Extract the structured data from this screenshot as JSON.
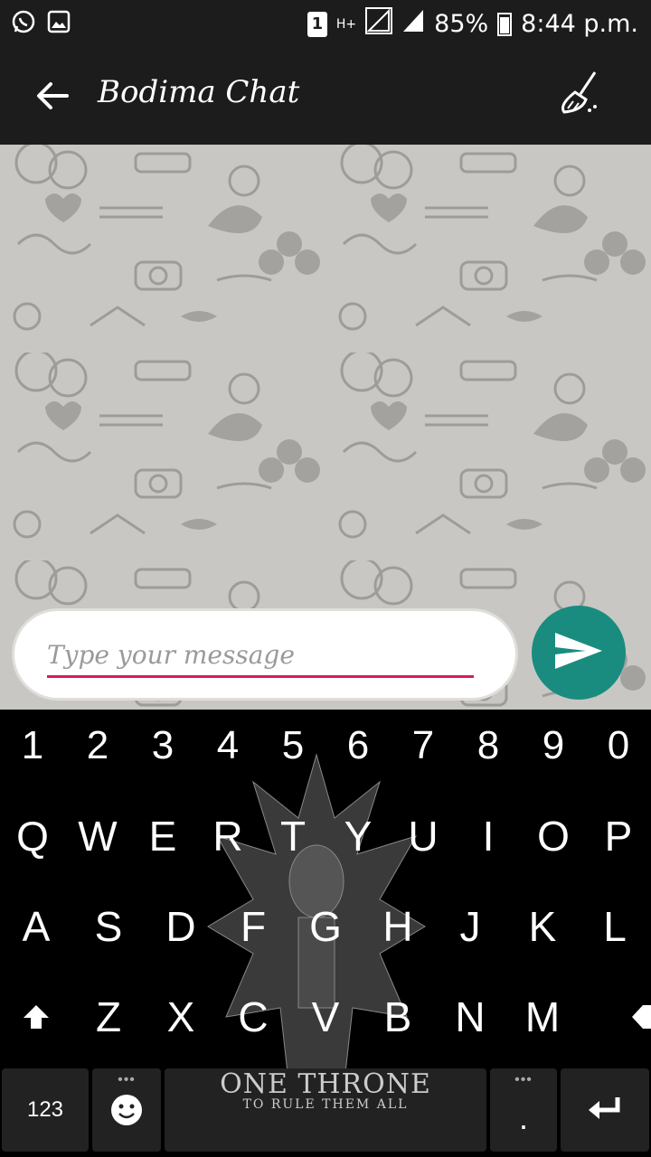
{
  "status_bar": {
    "sim_slot": "1",
    "network_type": "H+",
    "battery_percent": "85%",
    "time": "8:44 p.m.",
    "icons": [
      "whatsapp-icon",
      "gallery-icon",
      "signal-icon",
      "battery-icon"
    ]
  },
  "app_bar": {
    "title": "Bodima Chat",
    "back_icon": "arrow-left-icon",
    "clear_icon": "broom-icon"
  },
  "chat": {
    "messages": []
  },
  "composer": {
    "placeholder": "Type your message",
    "value": "",
    "send_icon": "send-icon",
    "underline_color": "#d81b60",
    "send_color": "#198c7f"
  },
  "keyboard": {
    "numbers": [
      "1",
      "2",
      "3",
      "4",
      "5",
      "6",
      "7",
      "8",
      "9",
      "0"
    ],
    "row1": [
      "Q",
      "W",
      "E",
      "R",
      "T",
      "Y",
      "U",
      "I",
      "O",
      "P"
    ],
    "row2": [
      "A",
      "S",
      "D",
      "F",
      "G",
      "H",
      "J",
      "K",
      "L"
    ],
    "row3": [
      "Z",
      "X",
      "C",
      "V",
      "B",
      "N",
      "M"
    ],
    "symbols_key": "123",
    "period_key": ".",
    "dots": "•••",
    "theme_title": "ONE THRONE",
    "theme_subtitle": "TO RULE THEM ALL"
  }
}
